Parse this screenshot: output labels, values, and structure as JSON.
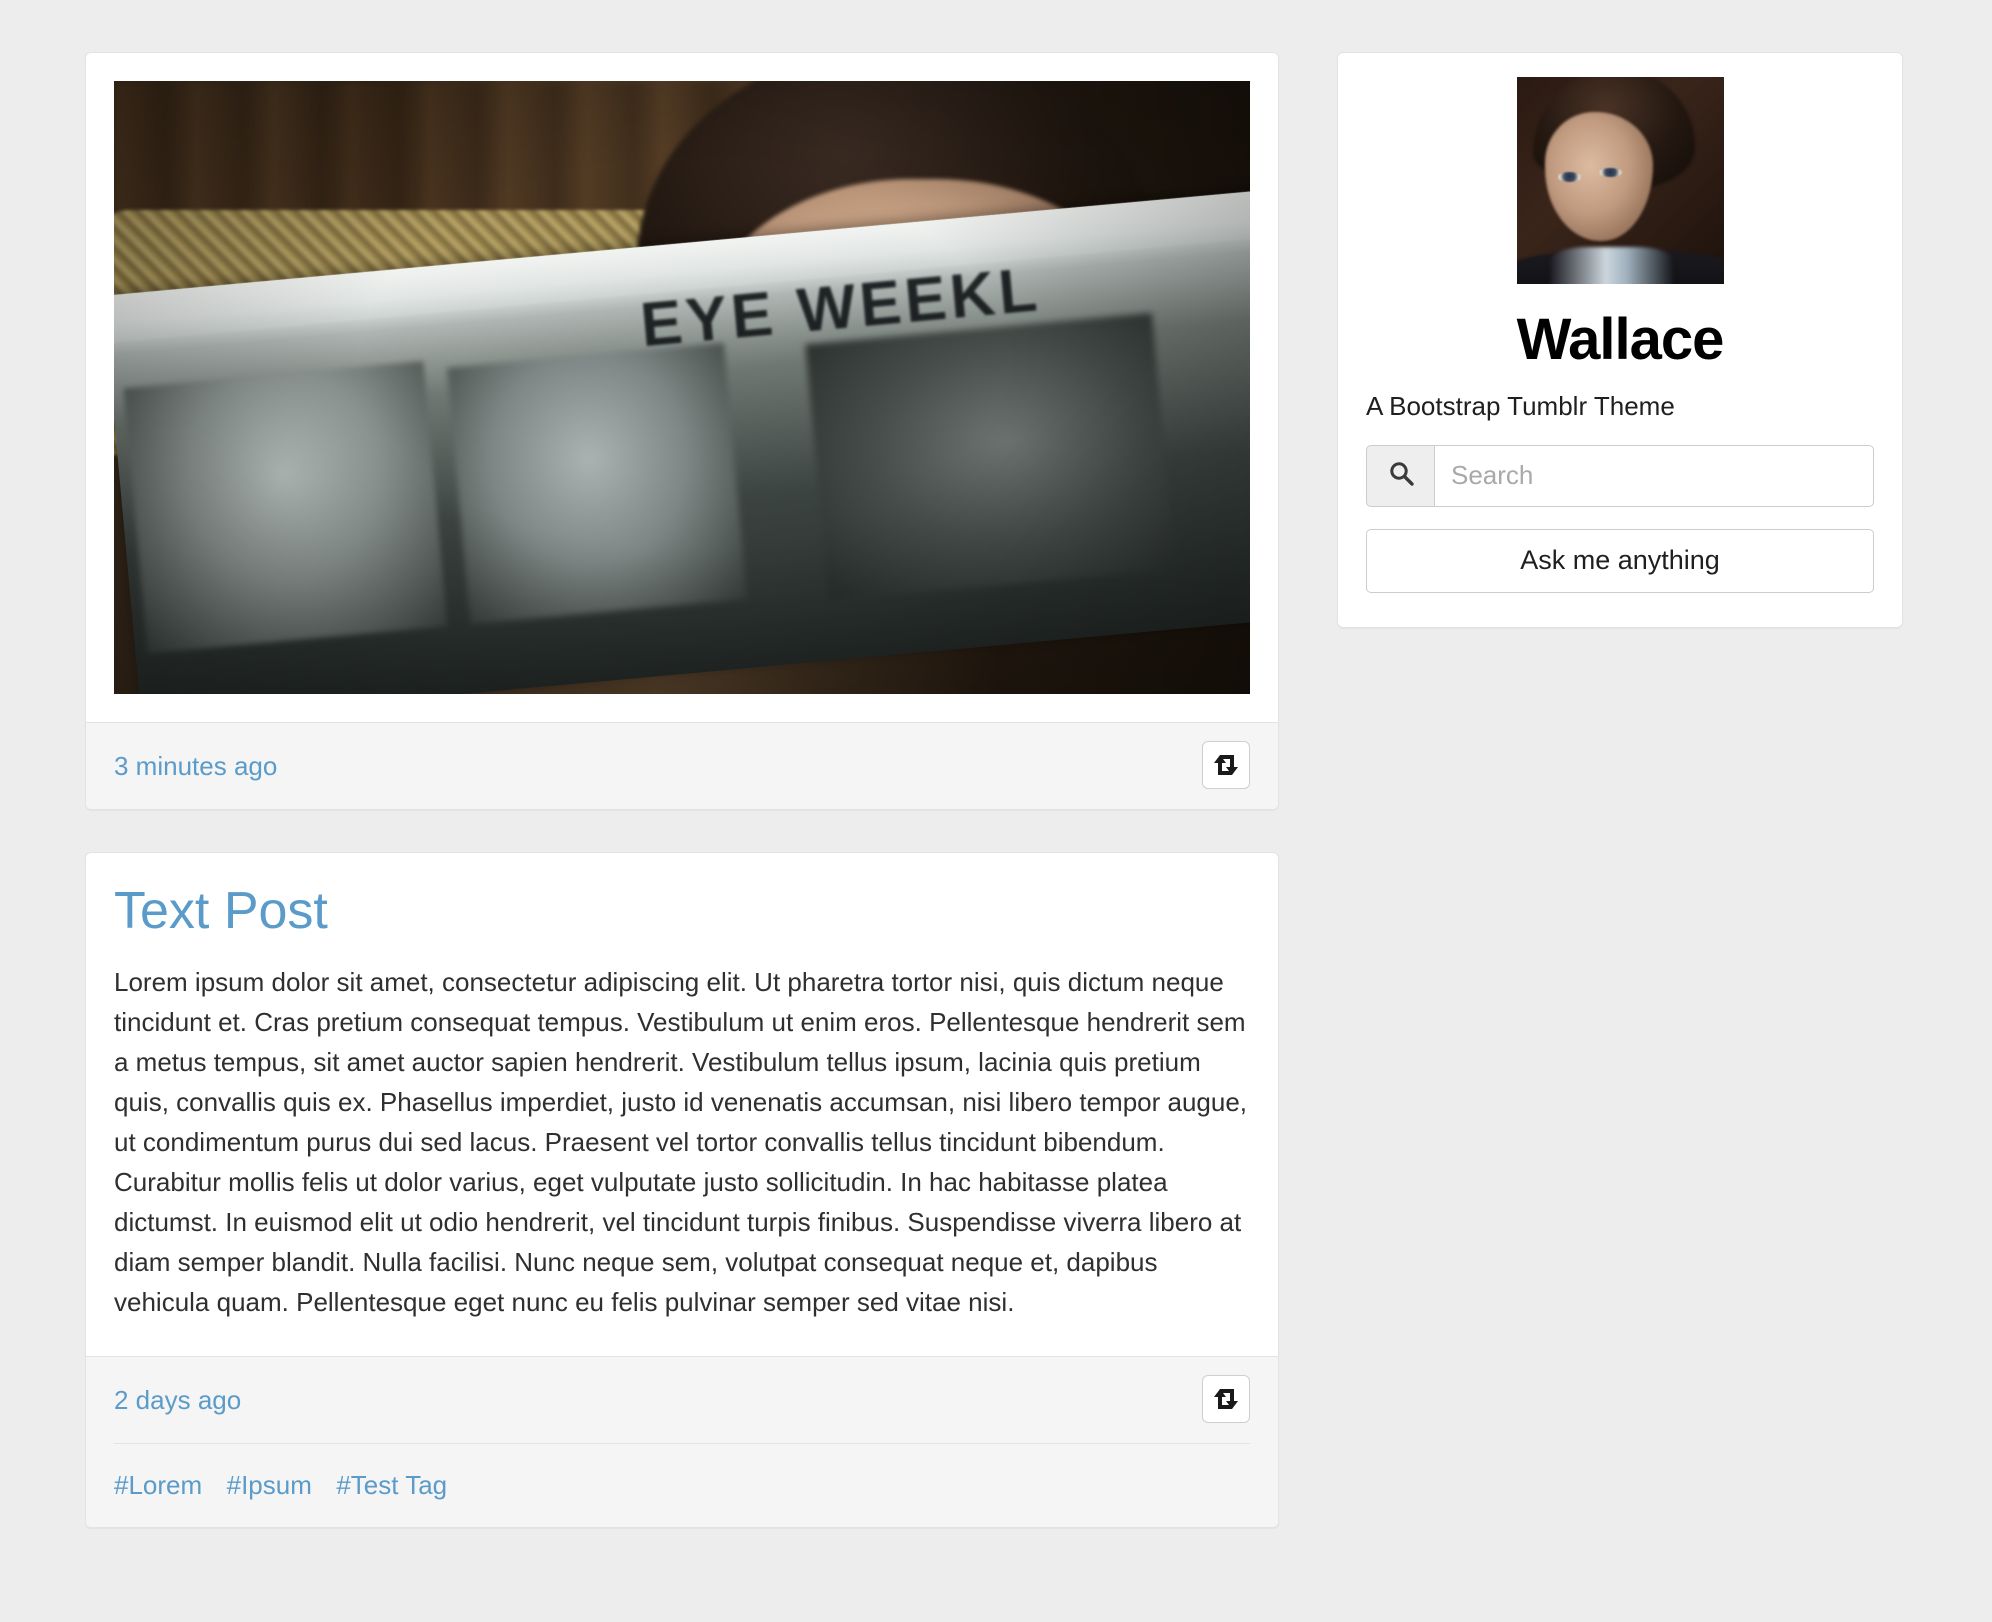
{
  "blog": {
    "title": "Wallace",
    "description": "A Bootstrap Tumblr Theme",
    "avatar_alt": "portrait-photo"
  },
  "search": {
    "placeholder": "Search",
    "value": "",
    "icon": "search-icon"
  },
  "ask": {
    "label": "Ask me anything"
  },
  "posts": [
    {
      "type": "photo",
      "image_caption": "EYE WEEKL",
      "timestamp": "3 minutes ago",
      "reblog_icon": "reblog-icon",
      "tags": []
    },
    {
      "type": "text",
      "title": "Text Post",
      "body": "Lorem ipsum dolor sit amet, consectetur adipiscing elit. Ut pharetra tortor nisi, quis dictum neque tincidunt et. Cras pretium consequat tempus. Vestibulum ut enim eros. Pellentesque hendrerit sem a metus tempus, sit amet auctor sapien hendrerit. Vestibulum tellus ipsum, lacinia quis pretium quis, convallis quis ex. Phasellus imperdiet, justo id venenatis accumsan, nisi libero tempor augue, ut condimentum purus dui sed lacus. Praesent vel tortor convallis tellus tincidunt bibendum. Curabitur mollis felis ut dolor varius, eget vulputate justo sollicitudin. In hac habitasse platea dictumst. In euismod elit ut odio hendrerit, vel tincidunt turpis finibus. Suspendisse viverra libero at diam semper blandit. Nulla facilisi. Nunc neque sem, volutpat consequat neque et, dapibus vehicula quam. Pellentesque eget nunc eu felis pulvinar semper sed vitae nisi.",
      "timestamp": "2 days ago",
      "reblog_icon": "reblog-icon",
      "tags": [
        "#Lorem",
        "#Ipsum",
        "#Test Tag"
      ]
    }
  ],
  "colors": {
    "page_background": "#ededed",
    "card_background": "#ffffff",
    "footer_background": "#f5f5f5",
    "link": "#5b9bc9",
    "border": "#e3e3e3",
    "text": "#2f2f2f"
  }
}
